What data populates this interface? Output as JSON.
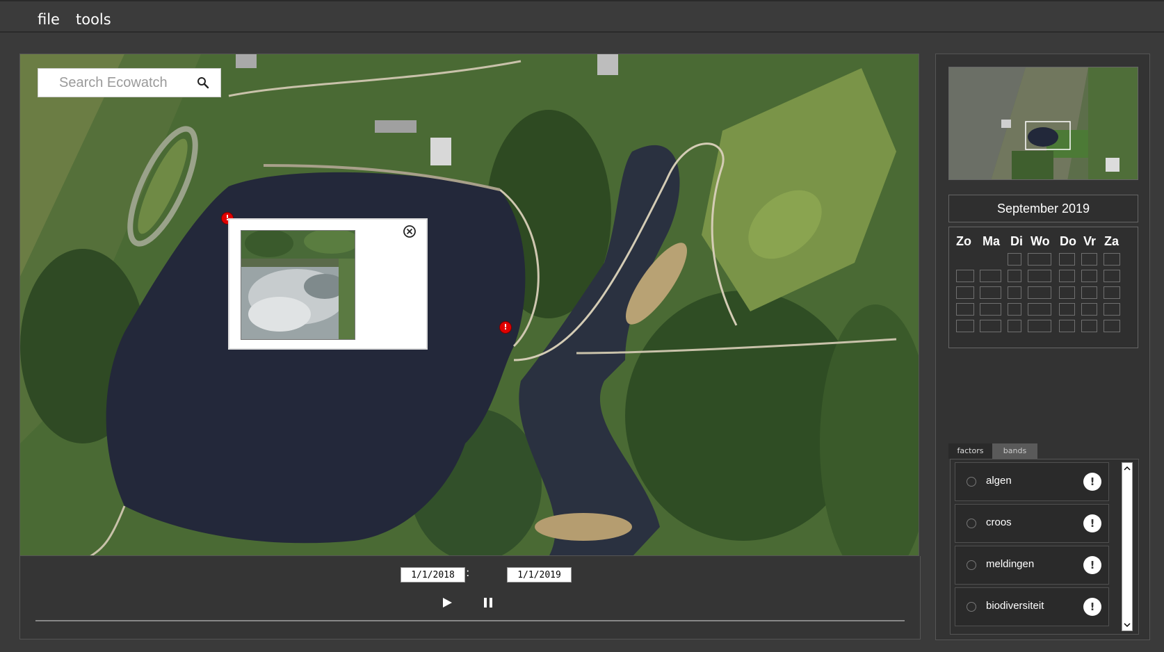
{
  "menu": {
    "items": [
      {
        "label": "file"
      },
      {
        "label": "tools"
      }
    ]
  },
  "search": {
    "placeholder": "Search Ecowatch"
  },
  "timeline": {
    "start_date": "1/1/2018",
    "separator": ":",
    "end_date": "1/1/2019"
  },
  "calendar": {
    "month": "September 2019",
    "days": [
      "Zo",
      "Ma",
      "Di",
      "Wo",
      "Do",
      "Vr",
      "Za"
    ]
  },
  "tabs": [
    {
      "label": "factors"
    },
    {
      "label": "bands"
    }
  ],
  "factors": [
    {
      "label": "algen"
    },
    {
      "label": "croos"
    },
    {
      "label": "meldingen"
    },
    {
      "label": "biodiversiteit"
    }
  ],
  "marker": {
    "glyph": "!"
  },
  "colors": {
    "background": "#3a3a3a",
    "marker": "#e00000",
    "panel": "#333333"
  }
}
